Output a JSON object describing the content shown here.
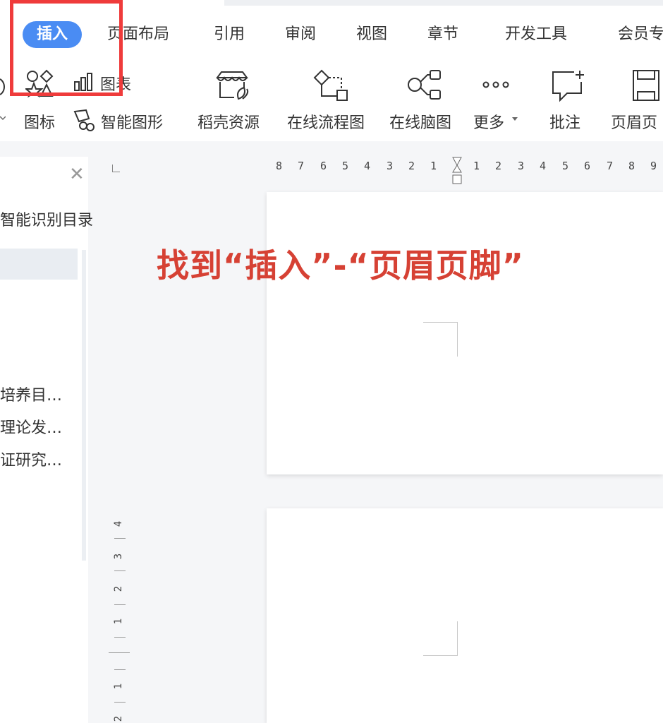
{
  "tabs": [
    {
      "label": "插入",
      "active": true
    },
    {
      "label": "页面布局"
    },
    {
      "label": "引用"
    },
    {
      "label": "审阅"
    },
    {
      "label": "视图"
    },
    {
      "label": "章节"
    },
    {
      "label": "开发工具"
    },
    {
      "label": "会员专"
    }
  ],
  "ribbon": {
    "chart_label": "图表",
    "icon_label": "图标",
    "smart_shape_label": "智能图形",
    "docer_label": "稻壳资源",
    "flowchart_label": "在线流程图",
    "mindmap_label": "在线脑图",
    "more_label": "更多",
    "comment_label": "批注",
    "header_footer_label": "页眉页"
  },
  "nav": {
    "title": "智能识别目录",
    "items": [
      "培养目…",
      "理论发…",
      "证研究…"
    ]
  },
  "ruler": {
    "h_left": [
      "8",
      "7",
      "6",
      "5",
      "4",
      "3",
      "2",
      "1"
    ],
    "h_right": [
      "1",
      "2",
      "3",
      "4",
      "5",
      "6",
      "7",
      "8",
      "9"
    ],
    "v": [
      "4",
      "3",
      "2",
      "1",
      "1",
      "2"
    ]
  },
  "caption": "找到“插入”-“页眉页脚”",
  "colors": {
    "accent": "#4a8cf3",
    "highlight": "#ef3b3b",
    "caption": "#d64134"
  }
}
